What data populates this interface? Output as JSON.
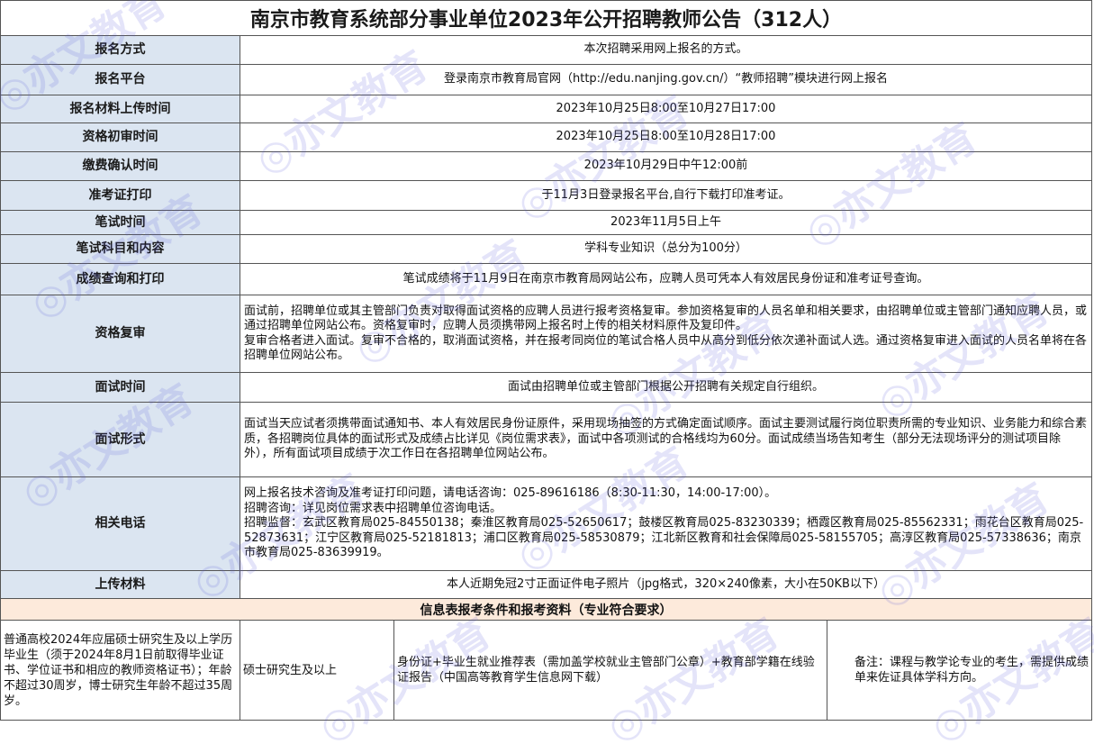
{
  "title": "南京市教育系统部分事业单位2023年公开招聘教师公告（312人）",
  "rows": [
    {
      "label": "报名方式",
      "value": "本次招聘采用网上报名的方式。"
    },
    {
      "label": "报名平台",
      "value": "登录南京市教育局官网（http://edu.nanjing.gov.cn/）“教师招聘”模块进行网上报名"
    },
    {
      "label": "报名材料上传时间",
      "value": "2023年10月25日8:00至10月27日17:00"
    },
    {
      "label": "资格初审时间",
      "value": "2023年10月25日8:00至10月28日17:00"
    },
    {
      "label": "缴费确认时间",
      "value": "2023年10月29日中午12:00前"
    },
    {
      "label": "准考证打印",
      "value": "于11月3日登录报名平台,自行下载打印准考证。"
    },
    {
      "label": "笔试时间",
      "value": "2023年11月5日上午"
    },
    {
      "label": "笔试科目和内容",
      "value": "学科专业知识（总分为100分）"
    },
    {
      "label": "成绩查询和打印",
      "value": "笔试成绩将于11月9日在南京市教育局网站公布，应聘人员可凭本人有效居民身份证和准考证号查询。"
    },
    {
      "label": "资格复审",
      "value": "面试前，招聘单位或其主管部门负责对取得面试资格的应聘人员进行报考资格复审。参加资格复审的人员名单和相关要求，由招聘单位或主管部门通知应聘人员，或通过招聘单位网站公布。资格复审时，应聘人员须携带网上报名时上传的相关材料原件及复印件。",
      "value2": "复审合格者进入面试。复审不合格的，取消面试资格，并在报考同岗位的笔试合格人员中从高分到低分依次递补面试人选。通过资格复审进入面试的人员名单将在各招聘单位网站公布。"
    },
    {
      "label": "面试时间",
      "value": "面试由招聘单位或主管部门根据公开招聘有关规定自行组织。"
    },
    {
      "label": "面试形式",
      "value": "面试当天应试者须携带面试通知书、本人有效居民身份证原件，采用现场抽签的方式确定面试顺序。面试主要测试履行岗位职责所需的专业知识、业务能力和综合素质，各招聘岗位具体的面试形式及成绩占比详见《岗位需求表》，面试中各项测试的合格线均为60分。面试成绩当场告知考生（部分无法现场评分的测试项目除外），所有面试项目成绩于次工作日在各招聘单位网站公布。"
    },
    {
      "label": "相关电话",
      "value": "网上报名技术咨询及准考证打印问题，请电话咨询：025-89616186（8:30-11:30，14:00-17:00）。",
      "value2": "招聘咨询：详见岗位需求表中招聘单位咨询电话。",
      "value3": "招聘监督：玄武区教育局025-84550138；秦淮区教育局025-52650617；鼓楼区教育局025-83230339；栖霞区教育局025-85562331；雨花台区教育局025-52873631；江宁区教育局025-52181813；浦口区教育局025-58530879；江北新区教育和社会保障局025-58155705；高淳区教育局025-57338636；南京市教育局025-83639919。"
    },
    {
      "label": "上传材料",
      "value": "本人近期免冠2寸正面证件电子照片（jpg格式，320×240像素，大小在50KB以下）"
    }
  ],
  "section_title": "信息表报考条件和报考资料（专业符合要求）",
  "bottom": {
    "c1": "普通高校2024年应届硕士研究生及以上学历毕业生（须于2024年8月1日前取得毕业证书、学位证书和相应的教师资格证书）；年龄不超过30周岁，博士研究生年龄不超过35周岁。",
    "c2": "硕士研究生及以上",
    "c3": "身份证+毕业生就业推荐表（需加盖学校就业主管部门公章）+教育部学籍在线验证报告（中国高等教育学生信息网下载）",
    "c4": "备注：课程与教学论专业的考生，需提供成绩单来佐证具体学科方向。"
  },
  "watermark_text": "◎亦文教育"
}
